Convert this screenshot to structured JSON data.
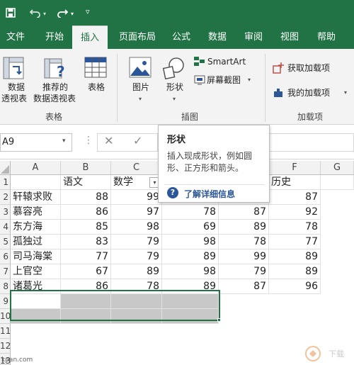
{
  "quick_access": {
    "save_icon": "save-icon",
    "undo_icon": "undo-icon",
    "redo_icon": "redo-icon",
    "customize_icon": "customize-icon"
  },
  "tabs": [
    {
      "label": "文件"
    },
    {
      "label": "开始"
    },
    {
      "label": "插入",
      "active": true
    },
    {
      "label": "页面布局"
    },
    {
      "label": "公式"
    },
    {
      "label": "数据"
    },
    {
      "label": "审阅"
    },
    {
      "label": "视图"
    },
    {
      "label": "帮助"
    }
  ],
  "ribbon": {
    "pivot_line1": "数据",
    "pivot_line2": "透视表",
    "recommended_line1": "推荐的",
    "recommended_line2": "数据透视表",
    "table": "表格",
    "group_tables": "表格",
    "pictures": "图片",
    "shapes": "形状",
    "smartart": "SmartArt",
    "screenshot": "屏幕截图",
    "group_illustrations": "插图",
    "get_addins": "获取加载项",
    "my_addins": "我的加载项",
    "group_addins": "加载项"
  },
  "formula_bar": {
    "name_box": "A9"
  },
  "tooltip": {
    "title": "形状",
    "body": "插入现成形状，例如圆形、正方形和箭头。",
    "link": "了解详细信息"
  },
  "sheet": {
    "columns": [
      "A",
      "B",
      "C",
      "D",
      "E",
      "F",
      "G"
    ],
    "rows": [
      "1",
      "2",
      "3",
      "4",
      "5",
      "6",
      "7",
      "8",
      "9",
      "10",
      "11",
      "12",
      "13"
    ],
    "header_row": [
      "",
      "语文",
      "数学",
      "",
      "",
      "历史"
    ],
    "data": [
      [
        "轩辕求败",
        "88",
        "99",
        "",
        "",
        "87"
      ],
      [
        "慕容亮",
        "86",
        "97",
        "78",
        "87",
        "92"
      ],
      [
        "东方海",
        "85",
        "98",
        "69",
        "89",
        "78"
      ],
      [
        "孤独过",
        "83",
        "79",
        "98",
        "78",
        "77"
      ],
      [
        "司马海棠",
        "77",
        "79",
        "89",
        "99",
        "89"
      ],
      [
        "上官空",
        "67",
        "89",
        "98",
        "79",
        "89"
      ],
      [
        "诸葛光",
        "86",
        "78",
        "89",
        "87",
        "96"
      ]
    ]
  },
  "watermark": {
    "left": "kpan.com",
    "right": "下载"
  },
  "colors": {
    "excel_green": "#217346",
    "selection_gray": "#c8c8c8",
    "link_blue": "#2b579a"
  }
}
